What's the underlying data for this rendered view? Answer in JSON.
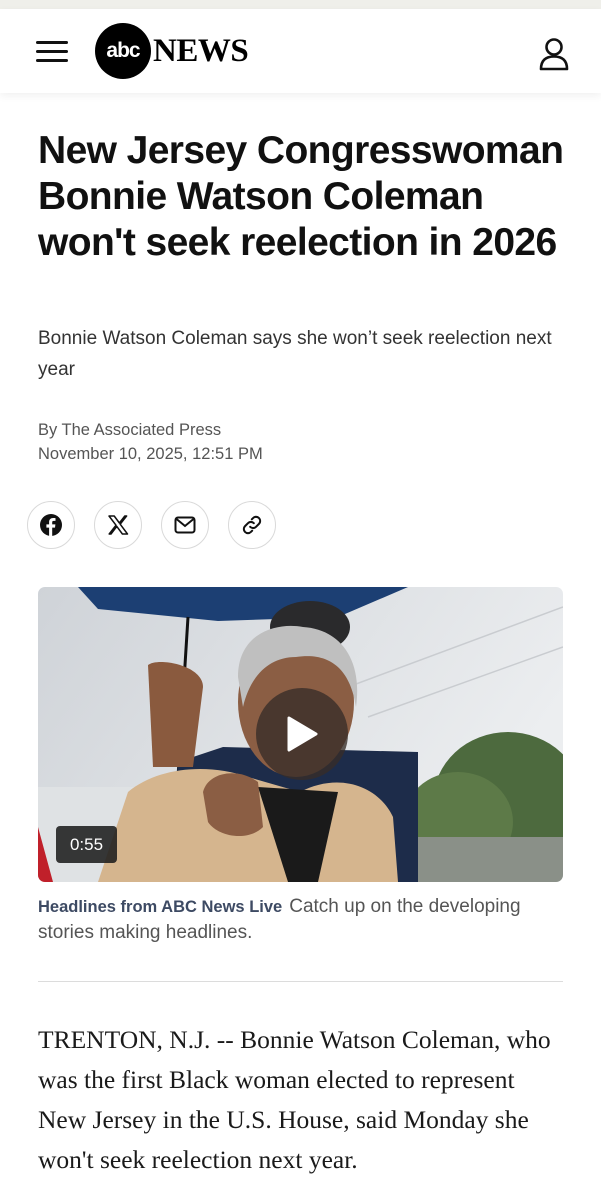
{
  "header": {
    "brand_abc": "abc",
    "brand_news": "NEWS",
    "menu_icon": "hamburger-menu-icon",
    "account_icon": "user-icon"
  },
  "article": {
    "headline": "New Jersey Congresswoman Bonnie Watson Coleman won't seek reelection in 2026",
    "subheadline": "Bonnie Watson Coleman says she won’t seek reelection next year",
    "byline": "By The Associated Press",
    "date": "November 10, 2025, 12:51 PM",
    "share_icons": [
      "facebook-icon",
      "x-icon",
      "email-icon",
      "link-icon"
    ],
    "video": {
      "duration": "0:55",
      "caption_title": "Headlines from ABC News Live",
      "caption_text": "Catch up on the developing stories making headlines."
    },
    "body_first_paragraph": "TRENTON, N.J. -- Bonnie Watson Coleman, who was the first Black woman elected to represent New Jersey in the U.S. House, said Monday she won't seek reelection next year."
  },
  "colors": {
    "brand": "#000000",
    "caption_title": "#3d4a63",
    "text_muted": "#555555"
  }
}
